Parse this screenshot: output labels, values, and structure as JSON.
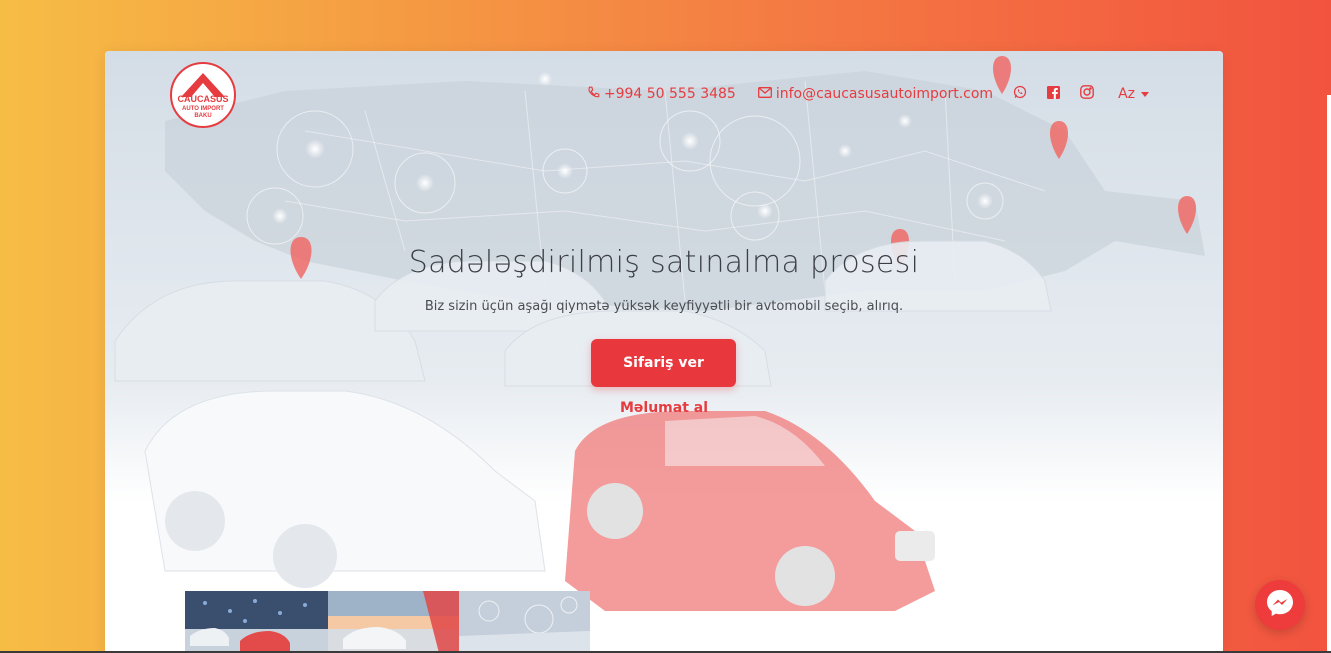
{
  "brand": {
    "logo_line1": "CAUCASUS",
    "logo_line2": "AUTO IMPORT",
    "logo_line3": "BAKU"
  },
  "nav": {
    "phone": "+994 50 555 3485",
    "email": "info@caucasusautoimport.com",
    "language": "Az",
    "icons": [
      "phone-icon",
      "mail-icon",
      "whatsapp-icon",
      "facebook-icon",
      "instagram-icon"
    ]
  },
  "hero": {
    "title": "Sadələşdirilmiş satınalma prosesi",
    "subtitle": "Biz sizin üçün aşağı qiymətə yüksək keyfiyyətli bir avtomobil seçib, alırıq.",
    "cta_label": "Sifariş ver",
    "info_label": "Məlumat al"
  },
  "colors": {
    "accent": "#e8383d",
    "text_dark": "#3c3f45",
    "gradient_start": "#f6bd45",
    "gradient_end": "#f2533f"
  }
}
